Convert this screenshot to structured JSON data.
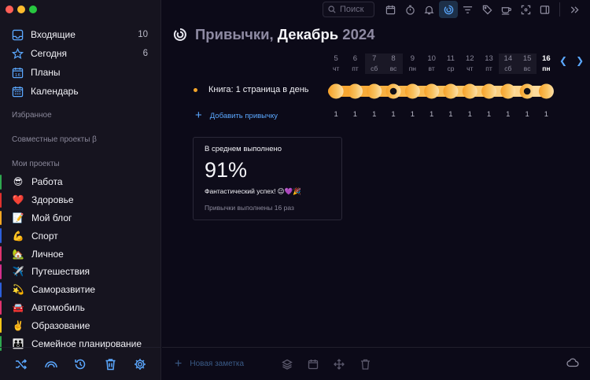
{
  "sidebar": {
    "nav": [
      {
        "label": "Входящие",
        "count": "10",
        "icon": "inbox-icon"
      },
      {
        "label": "Сегодня",
        "count": "6",
        "icon": "star-icon"
      },
      {
        "label": "Планы",
        "count": "",
        "icon": "calendar-day-icon"
      },
      {
        "label": "Календарь",
        "count": "",
        "icon": "calendar-icon"
      }
    ],
    "favorites_label": "Избранное",
    "shared_label": "Совместные проекты β",
    "my_projects_label": "Мои проекты",
    "projects": [
      {
        "emoji": "😎",
        "label": "Работа",
        "color": "#2fa84f"
      },
      {
        "emoji": "❤️",
        "label": "Здоровье",
        "color": "#e0312e"
      },
      {
        "emoji": "📝",
        "label": "Мой блог",
        "color": "#f5a623"
      },
      {
        "emoji": "💪",
        "label": "Спорт",
        "color": "#2c5fdb"
      },
      {
        "emoji": "🏡",
        "label": "Личное",
        "color": "#e0336e"
      },
      {
        "emoji": "✈️",
        "label": "Путешествия",
        "color": "#d62f8c"
      },
      {
        "emoji": "💫",
        "label": "Саморазвитие",
        "color": "#2c5fdb"
      },
      {
        "emoji": "🚘",
        "label": "Автомобиль",
        "color": "#e0336e"
      },
      {
        "emoji": "✌️",
        "label": "Образование",
        "color": "#f5c518"
      },
      {
        "emoji": "👪",
        "label": "Семейное планирование",
        "color": "#2fa84f"
      }
    ]
  },
  "toolbar": {
    "search_placeholder": "Поиск"
  },
  "main": {
    "title_part1": "Привычки,",
    "title_part2": "Декабрь",
    "title_part3": "2024",
    "days": [
      {
        "n": "5",
        "w": "чт"
      },
      {
        "n": "6",
        "w": "пт"
      },
      {
        "n": "7",
        "w": "сб"
      },
      {
        "n": "8",
        "w": "вс"
      },
      {
        "n": "9",
        "w": "пн"
      },
      {
        "n": "10",
        "w": "вт"
      },
      {
        "n": "11",
        "w": "ср"
      },
      {
        "n": "12",
        "w": "чт"
      },
      {
        "n": "13",
        "w": "пт"
      },
      {
        "n": "14",
        "w": "сб"
      },
      {
        "n": "15",
        "w": "вс"
      },
      {
        "n": "16",
        "w": "пн"
      }
    ],
    "habit_name": "Книга: 1 страница в день",
    "habit_color": "#f4a52a",
    "add_habit": "Добавить привычку",
    "counts": [
      "1",
      "1",
      "1",
      "1",
      "1",
      "1",
      "1",
      "1",
      "1",
      "1",
      "1",
      "1"
    ]
  },
  "stats": {
    "heading": "В среднем выполнено",
    "percent": "91%",
    "message": "Фантастический успех! 😉💜🎉",
    "sub": "Привычки выполнены 16 раз"
  },
  "bottom": {
    "new_note": "Новая заметка"
  }
}
